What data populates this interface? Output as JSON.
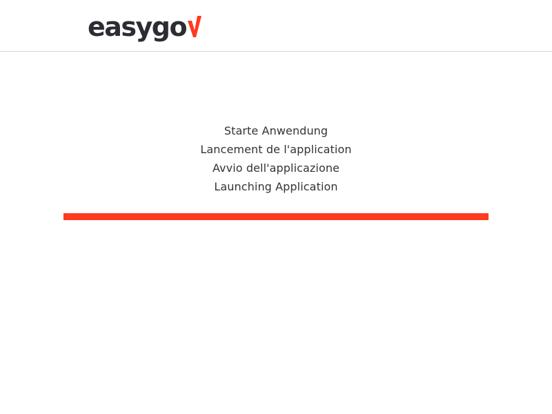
{
  "header": {
    "logo": {
      "text": "easygo",
      "mark_icon": "check-v-icon",
      "mark_color": "#ff3a1e",
      "text_color": "#2b2d33"
    }
  },
  "main": {
    "messages": [
      "Starte Anwendung",
      "Lancement de l'application",
      "Avvio dell'applicazione",
      "Launching Application"
    ],
    "progress": {
      "percent": 100,
      "color": "#ff3a1e"
    }
  }
}
